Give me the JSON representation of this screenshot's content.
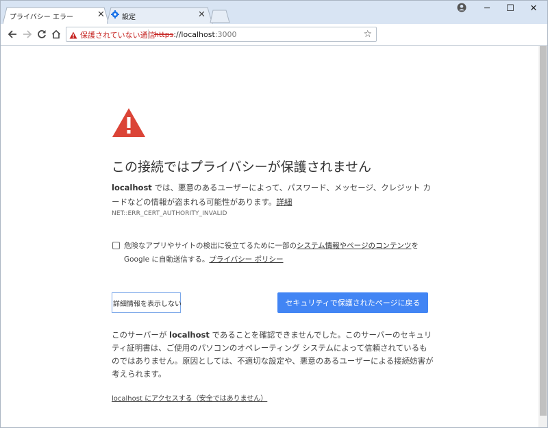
{
  "tabs": [
    {
      "title": "プライバシー エラー",
      "active": true
    },
    {
      "title": "設定",
      "active": false
    }
  ],
  "window_controls": {
    "minimize": "─",
    "maximize": "☐",
    "close": "✕"
  },
  "toolbar": {
    "security_label": "保護されていない通信",
    "url_scheme": "https",
    "url_host": "://localhost",
    "url_port": ":3000"
  },
  "content": {
    "heading": "この接続ではプライバシーが保護されません",
    "para1_host": "localhost",
    "para1_text": " では、悪意のあるユーザーによって、パスワード、メッセージ、クレジット カードなどの情報が盗まれる可能性があります。",
    "para1_link": "詳細",
    "error_code": "NET::ERR_CERT_AUTHORITY_INVALID",
    "checkbox_text_1": "危険なアプリやサイトの検出に役立てるために一部の",
    "checkbox_link_1": "システム情報やページのコンテンツ",
    "checkbox_text_2": "を Google に自動送信する。",
    "checkbox_link_2": "プライバシー ポリシー",
    "details_button": "詳細情報を表示しない",
    "back_button": "セキュリティで保護されたページに戻る",
    "para2_prefix": "このサーバーが ",
    "para2_host": "localhost",
    "para2_text": " であることを確認できませんでした。このサーバーのセキュリティ証明書は、ご使用のパソコンのオペレーティング システムによって信頼されているものではありません。原因としては、不適切な設定や、悪意のあるユーザーによる接続妨害が考えられます。",
    "proceed_link": "localhost にアクセスする（安全ではありません）"
  },
  "colors": {
    "warning_red": "#db4437",
    "primary_button": "#4285f4",
    "insecure_text": "#c5221f"
  }
}
